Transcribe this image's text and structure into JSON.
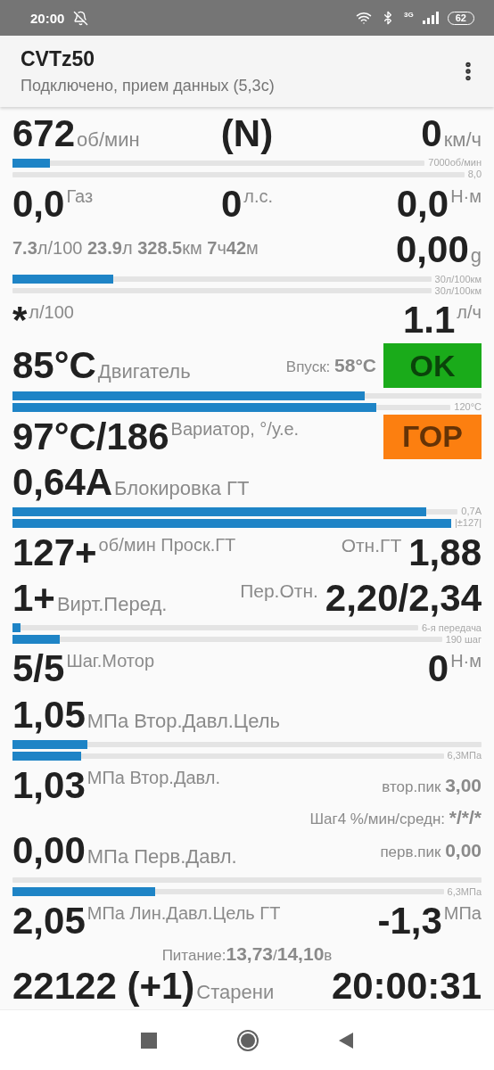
{
  "status_bar": {
    "time": "20:00",
    "network": "3G",
    "battery": "62"
  },
  "app_bar": {
    "title": "CVTz50",
    "subtitle": "Подключено, прием данных (5,3с)"
  },
  "rows": [
    {
      "kind": "readings",
      "left": {
        "value": "672",
        "unit": "об/мин"
      },
      "center": {
        "value": "(N)"
      },
      "right": {
        "value": "0",
        "unit": "км/ч"
      }
    },
    {
      "kind": "bars",
      "bars": [
        {
          "kind": "filled",
          "level": 0.09,
          "caption": "7000об/мин"
        },
        {
          "kind": "empty",
          "caption": "8,0"
        }
      ]
    },
    {
      "kind": "raised-readings",
      "left": {
        "value": "0,0",
        "unit": "Газ"
      },
      "center": {
        "value": "0",
        "unit": "л.с."
      },
      "right": {
        "value": "0,0",
        "unit": "Н·м"
      }
    },
    {
      "kind": "readings",
      "trip": "**7.3**л/100 **23.9**л **328.5**км **7**ч**42**м",
      "right": {
        "value": "0,00",
        "unit": "g"
      }
    },
    {
      "kind": "bars",
      "bars": [
        {
          "kind": "filled",
          "level": 0.24,
          "caption": "30л/100км"
        },
        {
          "kind": "empty",
          "caption": "30л/100км"
        }
      ]
    },
    {
      "kind": "raised-readings",
      "left": {
        "value": "*",
        "unit": "л/100"
      },
      "right": {
        "value": "1.1",
        "unit": "л/ч"
      }
    },
    {
      "kind": "readings",
      "left": {
        "value": "85°C",
        "unit": "Двигатель"
      },
      "note": {
        "label": "Впуск:",
        "value": "58°C"
      },
      "badge": {
        "text": "OK",
        "color": "#1aab1a"
      }
    },
    {
      "kind": "bars",
      "bars": [
        {
          "kind": "filled",
          "level": 0.75
        },
        {
          "kind": "filled",
          "level": 0.83,
          "caption": "120°C"
        }
      ]
    },
    {
      "kind": "raised-readings",
      "left": {
        "value": "97°C/186",
        "unit": "Вариатор, °/у.е."
      },
      "badge": {
        "text": "ГОР",
        "color": "#fc7f10"
      }
    },
    {
      "kind": "readings",
      "left": {
        "value": "0,64A",
        "unit": "Блокировка ГТ"
      }
    },
    {
      "kind": "bars",
      "bars": [
        {
          "kind": "filled",
          "level": 0.93,
          "caption": "0,7A"
        },
        {
          "kind": "filled",
          "level": 1,
          "caption": "|±127|"
        }
      ]
    },
    {
      "kind": "raised-readings",
      "left": {
        "value": "127+",
        "unit": "об/мин Проск.ГТ"
      },
      "right": {
        "label": "Отн.ГТ",
        "value": "1,88"
      }
    },
    {
      "kind": "readings",
      "left": {
        "value": "1+",
        "unit": "Вирт.Перед."
      },
      "right": {
        "label": "Пер.Отн.",
        "value": "2,20/2,34"
      }
    },
    {
      "kind": "bars",
      "bars": [
        {
          "kind": "filled",
          "level": 0.02,
          "caption": "6-я передача"
        },
        {
          "kind": "filled",
          "level": 0.11,
          "caption": "190 шаг"
        }
      ]
    },
    {
      "kind": "raised-readings",
      "left": {
        "value": "5/5",
        "unit": "Шаг.Мотор"
      },
      "right": {
        "value": "0",
        "unit": "Н·м"
      }
    },
    {
      "kind": "readings",
      "left": {
        "value": "1,05",
        "unit": "МПа Втор.Давл.Цель"
      }
    },
    {
      "kind": "bars",
      "bars": [
        {
          "kind": "filled",
          "level": 0.16
        },
        {
          "kind": "filled",
          "level": 0.16,
          "caption": "6,3МПа"
        }
      ]
    },
    {
      "kind": "raised-readings",
      "left": {
        "value": "1,03",
        "unit": "МПа Втор.Давл."
      },
      "note": {
        "label": "втор.пик",
        "value": "3,00"
      }
    },
    {
      "kind": "note",
      "label": "Шаг4 %/мин/средн:",
      "value": "*/*/*"
    },
    {
      "kind": "readings",
      "left": {
        "value": "0,00",
        "unit": "МПа Перв.Давл."
      },
      "note": {
        "label": "перв.пик",
        "value": "0,00"
      }
    },
    {
      "kind": "bars",
      "bars": [
        {
          "kind": "empty"
        },
        {
          "kind": "filled",
          "level": 0.33,
          "caption": "6,3МПа"
        }
      ]
    },
    {
      "kind": "raised-readings",
      "left": {
        "value": "2,05",
        "unit": "МПа Лин.Давл.Цель ГТ"
      },
      "right": {
        "value": "-1,3",
        "unit": "МПа"
      }
    },
    {
      "kind": "note",
      "text": "Питание:**13,73**/**14,10**в"
    },
    {
      "kind": "readings",
      "left": {
        "value": "22122 (+1)",
        "unit": "Старени"
      },
      "right": {
        "value": "20:00:31"
      }
    }
  ]
}
